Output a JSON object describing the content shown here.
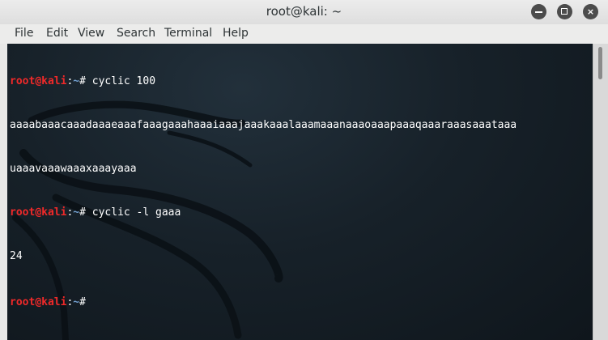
{
  "window": {
    "title": "root@kali: ~",
    "buttons": {
      "minimize": "−",
      "maximize": "□",
      "close": "×"
    }
  },
  "menu": [
    "File",
    "Edit",
    "View",
    "Search",
    "Terminal",
    "Help"
  ],
  "terminal": {
    "prompt": {
      "user": "root",
      "at": "@",
      "host": "kali",
      "sep": ":",
      "path": "~",
      "symbol": "# "
    },
    "lines": [
      {
        "type": "prompt",
        "command": "cyclic 100"
      },
      {
        "type": "output",
        "text": "aaaabaaacaaadaaaeaaafaaagaaahaaaiaaajaaakaaalaaamaaanaaaoaaapaaaqaaaraaasaaataaa"
      },
      {
        "type": "output",
        "text": "uaaavaaawaaaxaaayaaa"
      },
      {
        "type": "prompt",
        "command": "cyclic -l gaaa"
      },
      {
        "type": "output",
        "text": "24"
      },
      {
        "type": "prompt",
        "command": ""
      }
    ]
  },
  "colors": {
    "prompt_user": "#ef2929",
    "prompt_path": "#729fcf",
    "terminal_bg": "#172129"
  },
  "icons": [
    "minimize-icon",
    "maximize-icon",
    "close-icon",
    "kali-dragon-watermark"
  ]
}
